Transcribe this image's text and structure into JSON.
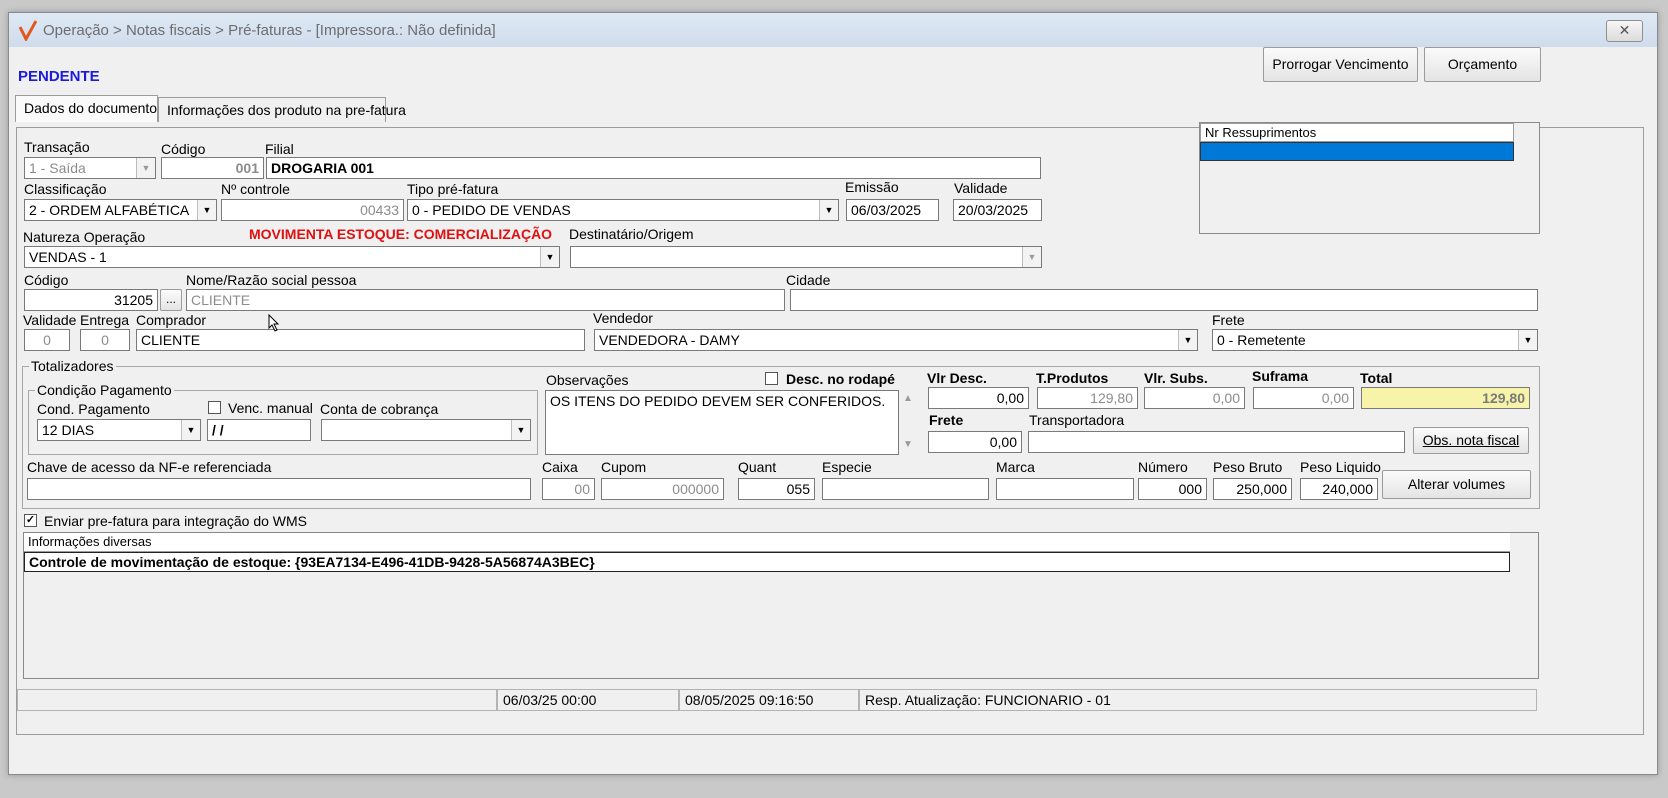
{
  "window": {
    "title": "Operação > Notas fiscais > Pré-faturas - [Impressora.: Não definida]",
    "close_label": "✕",
    "status": "PENDENTE"
  },
  "toolbar": {
    "prorrogar_label": "Prorrogar Vencimento",
    "orcamento_label": "Orçamento"
  },
  "tabs": [
    {
      "label": "Dados do documento"
    },
    {
      "label": "Informações dos produto na pre-fatura"
    }
  ],
  "form": {
    "transacao": {
      "label": "Transação",
      "value": "1 - Saída"
    },
    "codigo": {
      "label": "Código",
      "value": "001"
    },
    "filial": {
      "label": "Filial",
      "value": "DROGARIA 001"
    },
    "classificacao": {
      "label": "Classificação",
      "value": "2 - ORDEM ALFABÉTICA"
    },
    "nr_controle": {
      "label": "Nº controle",
      "value": "00433"
    },
    "tipo_prefatura": {
      "label": "Tipo pré-fatura",
      "value": "0 - PEDIDO DE VENDAS"
    },
    "emissao": {
      "label": "Emissão",
      "value": "06/03/2025"
    },
    "validade": {
      "label": "Validade",
      "value": "20/03/2025"
    },
    "natureza": {
      "label": "Natureza  Operação",
      "value": "VENDAS - 1"
    },
    "movimenta_warning": "MOVIMENTA ESTOQUE: COMERCIALIZAÇÃO",
    "destinatario": {
      "label": "Destinatário/Origem",
      "value": ""
    },
    "pessoa_codigo": {
      "label": "Código",
      "value": "31205"
    },
    "ellipsis": "...",
    "nome": {
      "label": "Nome/Razão social pessoa",
      "value": "CLIENTE"
    },
    "cidade": {
      "label": "Cidade",
      "value": ""
    },
    "validade_dias": {
      "label": "Validade",
      "value": "0"
    },
    "entrega": {
      "label": "Entrega",
      "value": "0"
    },
    "comprador": {
      "label": "Comprador",
      "value": "CLIENTE"
    },
    "vendedor": {
      "label": "Vendedor",
      "value": "VENDEDORA - DAMY"
    },
    "frete_tipo": {
      "label": "Frete",
      "value": "0 - Remetente"
    }
  },
  "ressuprimentos": {
    "header": "Nr Ressuprimentos"
  },
  "totalizadores": {
    "title": "Totalizadores",
    "condicao_group": "Condição Pagamento",
    "cond_pagamento": {
      "label": "Cond. Pagamento",
      "value": "12 DIAS"
    },
    "venc_manual": {
      "label": "Venc. manual",
      "value": " /  /"
    },
    "conta_cobranca": {
      "label": "Conta de cobrança",
      "value": ""
    },
    "observacoes": {
      "label": "Observações",
      "value": "OS ITENS DO PEDIDO DEVEM SER CONFERIDOS."
    },
    "desc_rodape": "Desc. no rodapé",
    "vlr_desc": {
      "label": "Vlr Desc.",
      "value": "0,00"
    },
    "t_produtos": {
      "label": "T.Produtos",
      "value": "129,80"
    },
    "vlr_subs": {
      "label": "Vlr. Subs.",
      "value": "0,00"
    },
    "suframa": {
      "label": "Suframa",
      "value": "0,00"
    },
    "total": {
      "label": "Total",
      "value": "129,80"
    },
    "frete": {
      "label": "Frete",
      "value": "0,00"
    },
    "transportadora": {
      "label": "Transportadora",
      "value": ""
    },
    "obs_nota_fiscal": "Obs. nota fiscal",
    "chave_acesso": {
      "label": "Chave de acesso da NF-e referenciada",
      "value": ""
    },
    "caixa": {
      "label": "Caixa",
      "value": "00"
    },
    "cupom": {
      "label": "Cupom",
      "value": "000000"
    },
    "quant": {
      "label": "Quant",
      "value": "055"
    },
    "especie": {
      "label": "Especie",
      "value": ""
    },
    "marca": {
      "label": "Marca",
      "value": ""
    },
    "numero": {
      "label": "Número",
      "value": "000"
    },
    "peso_bruto": {
      "label": "Peso Bruto",
      "value": "250,000"
    },
    "peso_liquido": {
      "label": "Peso Liquido",
      "value": "240,000"
    },
    "alterar_volumes": "Alterar volumes"
  },
  "wms": {
    "label": "Enviar pre-fatura para integração do WMS",
    "checked": true
  },
  "info": {
    "header": "Informações diversas",
    "row": "Controle de movimentação de estoque: {93EA7134-E496-41DB-9428-5A56874A3BEC}"
  },
  "statusbar": {
    "cell1": "06/03/25 00:00",
    "cell2": "08/05/2025 09:16:50",
    "cell3": "Resp. Atualização: FUNCIONARIO - 01"
  },
  "colors": {
    "title_status": "#1b1bd9",
    "warning": "#e01010",
    "total_bg": "#f7f3a9",
    "selection": "#0078d7"
  }
}
